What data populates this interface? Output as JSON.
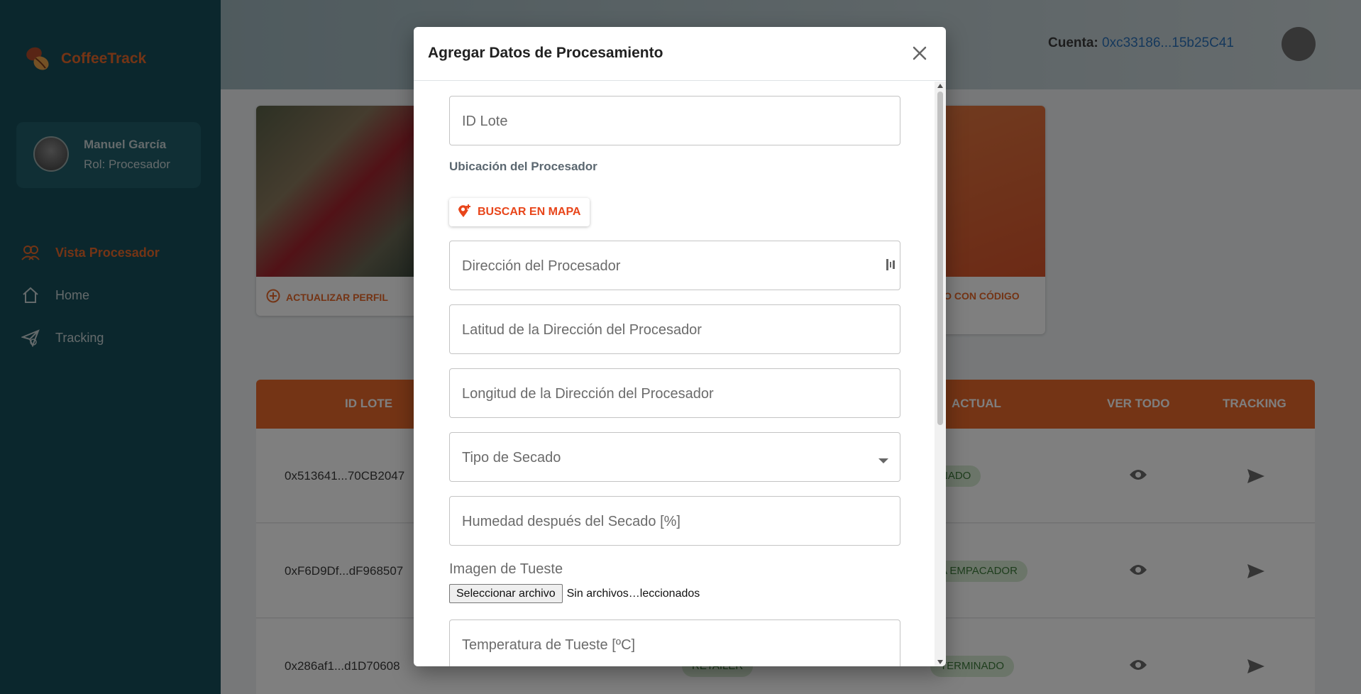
{
  "app": {
    "brand": "CoffeeTrack",
    "user": {
      "name": "Manuel García",
      "role": "Rol: Procesador"
    },
    "nav": [
      {
        "label": "Vista Procesador",
        "icon": "user-group-icon",
        "active": true
      },
      {
        "label": "Home",
        "icon": "home-icon",
        "active": false
      },
      {
        "label": "Tracking",
        "icon": "tracking-send-icon",
        "active": false
      }
    ],
    "account": {
      "label": "Cuenta:",
      "value": "0xc33186...15b25C41"
    },
    "cards": {
      "left_button": "ACTUALIZAR PERFIL",
      "right_button": "DO CON CÓDIGO"
    },
    "table": {
      "headers": [
        "ID LOTE",
        "ACTUAL",
        "VER TODO",
        "TRACKING"
      ],
      "rows": [
        {
          "id": "0x513641...70CB2047",
          "status": "NADO"
        },
        {
          "id": "0xF6D9Df...dF968507",
          "status": "A EMPACADOR"
        },
        {
          "id": "0x286af1...d1D70608",
          "stage": "RETAILER",
          "status": "TERMINADO"
        }
      ]
    },
    "colors": {
      "accent": "#e8692a",
      "sidebar": "#174e5a"
    }
  },
  "modal": {
    "title": "Agregar Datos de Procesamiento",
    "fields": {
      "id_lote": "ID Lote",
      "direccion": "Dirección del Procesador",
      "latitud": "Latitud de la Dirección del Procesador",
      "longitud": "Longitud de la Dirección del Procesador",
      "tipo_secado": "Tipo de Secado",
      "humedad": "Humedad después del Secado [%]",
      "temperatura": "Temperatura de Tueste [ºC]"
    },
    "section_label": "Ubicación del Procesador",
    "map_button": "BUSCAR EN MAPA",
    "image_label": "Imagen de Tueste",
    "file_button": "Seleccionar archivo",
    "file_status": "Sin archivos…leccionados"
  }
}
